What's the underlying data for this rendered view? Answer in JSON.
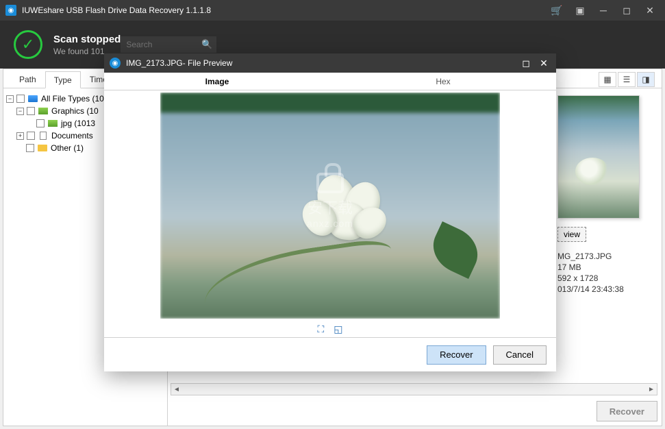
{
  "titlebar": {
    "app_name": "IUWEshare USB Flash Drive Data Recovery 1.1.1.8"
  },
  "status": {
    "title": "Scan stopped",
    "subtitle": "We found 101"
  },
  "search": {
    "placeholder": "Search"
  },
  "main_tabs": {
    "path": "Path",
    "type": "Type",
    "time": "Time"
  },
  "tree": {
    "root": "All File Types (10",
    "graphics": "Graphics (10",
    "jpg": "jpg (1013",
    "documents": "Documents",
    "other": "Other (1)"
  },
  "detail": {
    "preview_btn": "view",
    "filename": "MG_2173.JPG",
    "filesize": "17 MB",
    "dimensions": "592 x 1728",
    "datetime": "013/7/14 23:43:38"
  },
  "footer": {
    "recover": "Recover"
  },
  "modal": {
    "title": "IMG_2173.JPG- File Preview",
    "tab_image": "Image",
    "tab_hex": "Hex",
    "recover": "Recover",
    "cancel": "Cancel",
    "watermark_cn": "安下载",
    "watermark_url": "anxz.com"
  }
}
